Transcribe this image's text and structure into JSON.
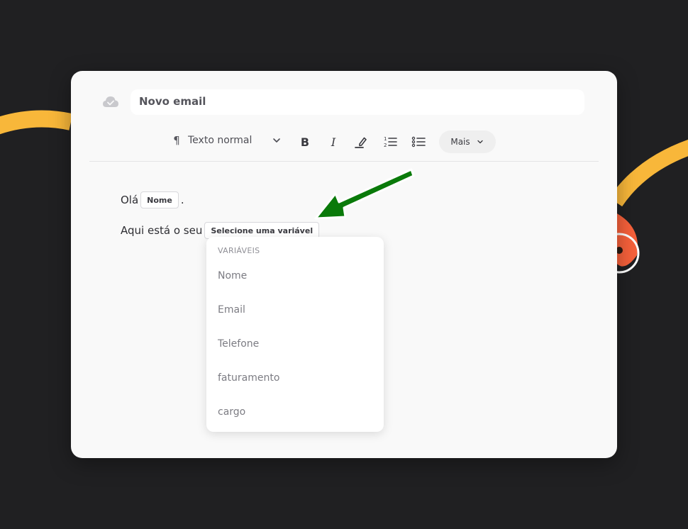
{
  "email": {
    "subject": "Novo email"
  },
  "toolbar": {
    "paragraph_icon": "¶",
    "text_format": "Texto normal",
    "bold_label": "B",
    "italic_label": "I",
    "more_label": "Mais"
  },
  "editor": {
    "line1_prefix": "Olá",
    "line1_chip": "Nome",
    "line1_suffix": ".",
    "line2_prefix": "Aqui está o seu",
    "line2_chip": "Selecione uma variável"
  },
  "dropdown": {
    "header": "VARIÁVEIS",
    "items": [
      "Nome",
      "Email",
      "Telefone",
      "faturamento",
      "cargo"
    ]
  },
  "icons": {
    "cloud": "cloud-check-icon",
    "paragraph": "paragraph-icon",
    "chevron": "chevron-down-icon",
    "highlight": "highlighter-icon",
    "ordered_list": "ordered-list-icon",
    "bullet_list": "bullet-list-icon",
    "arrow": "annotation-arrow-icon"
  },
  "colors": {
    "background": "#202022",
    "card": "#f9f9f9",
    "accent_yellow": "#f8b73a",
    "accent_orange": "#f7613b",
    "arrow_green": "#0a7a0a"
  }
}
